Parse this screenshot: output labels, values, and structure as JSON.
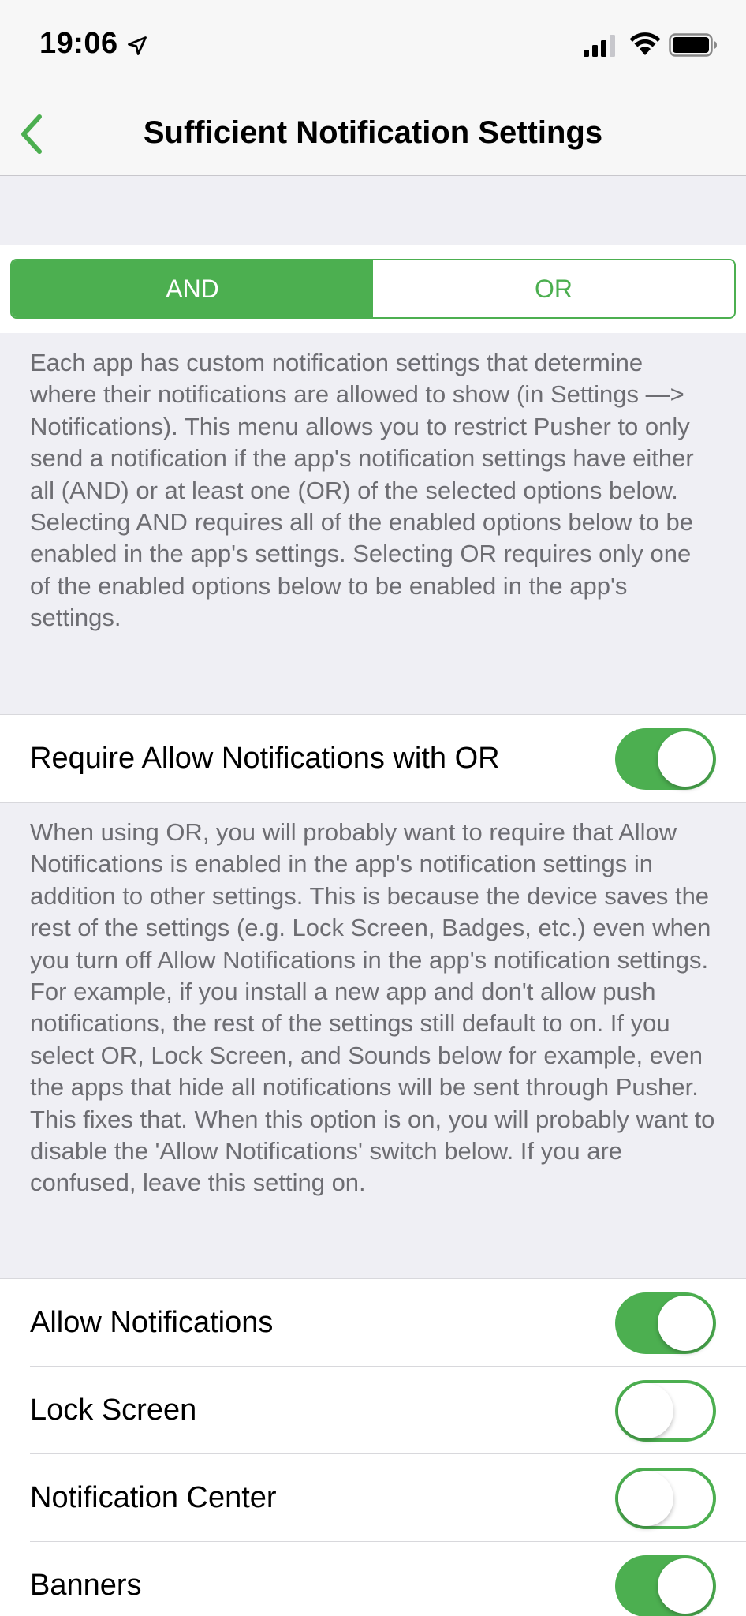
{
  "status_bar": {
    "time": "19:06",
    "icons": [
      "location-arrow-icon",
      "signal-icon",
      "wifi-icon",
      "battery-icon"
    ]
  },
  "nav": {
    "back_icon": "chevron-left-icon",
    "title": "Sufficient Notification Settings"
  },
  "segment": {
    "options": [
      "AND",
      "OR"
    ],
    "selected": "AND"
  },
  "mode_description": "Each app has custom notification settings that determine where their notifications are allowed to show (in Settings —> Notifications). This menu allows you to restrict Pusher to only send a notification if the app's notification settings have either all (AND) or at least one (OR) of the selected options below. Selecting AND requires all of the enabled options below to be enabled in the app's settings. Selecting OR requires only one of the enabled options below to be enabled in the app's settings.",
  "require_cell": {
    "label": "Require Allow Notifications with OR",
    "on": true
  },
  "require_description": "When using OR, you will probably want to require that Allow Notifications is enabled in the app's notification settings in addition to other settings. This is because the device saves the rest of the settings (e.g. Lock Screen, Badges, etc.) even when you turn off Allow Notifications in the app's notification settings. For example, if you install a new app and don't allow push notifications, the rest of the settings still default to on. If you select OR, Lock Screen, and Sounds below for example, even the apps that hide all notifications will be sent through Pusher. This fixes that. When this option is on, you will probably want to disable the 'Allow Notifications' switch below. If you are confused, leave this setting on.",
  "options": [
    {
      "label": "Allow Notifications",
      "on": true
    },
    {
      "label": "Lock Screen",
      "on": false
    },
    {
      "label": "Notification Center",
      "on": false
    },
    {
      "label": "Banners",
      "on": true
    }
  ],
  "colors": {
    "accent": "#4caf50",
    "background": "#efeff4",
    "footer_text": "#6d6d72"
  }
}
